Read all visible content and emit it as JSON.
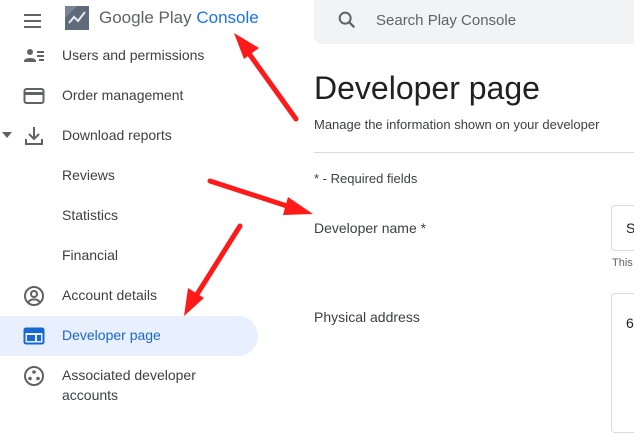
{
  "header": {
    "brand_google_play": "Google Play",
    "brand_console": "Console",
    "search_placeholder": "Search Play Console"
  },
  "sidebar": {
    "items": [
      {
        "label": "Users and permissions",
        "icon": "users-icon"
      },
      {
        "label": "Order management",
        "icon": "credit-card-icon"
      },
      {
        "label": "Download reports",
        "icon": "download-icon",
        "expanded": true
      },
      {
        "label": "Reviews"
      },
      {
        "label": "Statistics"
      },
      {
        "label": "Financial"
      },
      {
        "label": "Account details",
        "icon": "account-circle-icon"
      },
      {
        "label": "Developer page",
        "icon": "web-page-icon",
        "active": true
      },
      {
        "label": "Associated developer",
        "label_line2": "accounts",
        "icon": "associated-accounts-icon"
      }
    ]
  },
  "main": {
    "title": "Developer page",
    "description": "Manage the information shown on your developer",
    "required_note": "* - Required fields",
    "developer_name_label": "Developer name  *",
    "developer_name_value": "S",
    "developer_name_hint": "This",
    "physical_address_label": "Physical address",
    "physical_address_value": "6"
  },
  "colors": {
    "accent": "#1a73e8",
    "active_bg": "#e8f0fe",
    "annotation_arrow": "#ff1a1a"
  }
}
